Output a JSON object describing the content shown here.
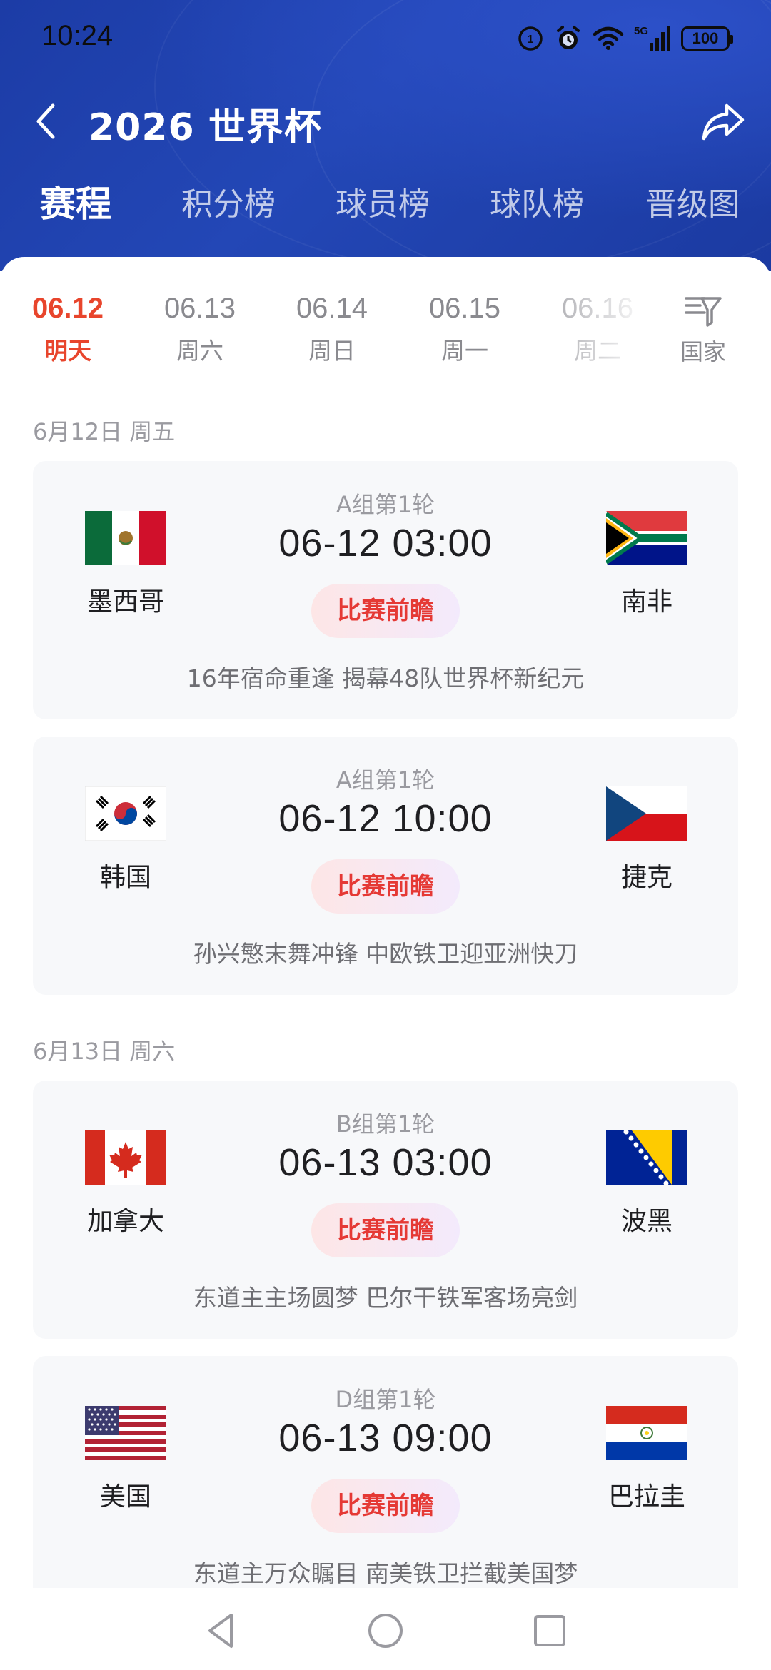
{
  "status_bar": {
    "time": "10:24",
    "battery": "100",
    "network": "5G"
  },
  "header": {
    "title": "2026 世界杯"
  },
  "tabs": [
    {
      "label": "赛程",
      "active": true
    },
    {
      "label": "积分榜"
    },
    {
      "label": "球员榜"
    },
    {
      "label": "球队榜"
    },
    {
      "label": "晋级图"
    }
  ],
  "dates": [
    {
      "date": "06.12",
      "weekday": "明天",
      "active": true
    },
    {
      "date": "06.13",
      "weekday": "周六"
    },
    {
      "date": "06.14",
      "weekday": "周日"
    },
    {
      "date": "06.15",
      "weekday": "周一"
    },
    {
      "date": "06.16",
      "weekday": "周二"
    }
  ],
  "filter": {
    "label": "国家"
  },
  "sections": [
    {
      "label": "6月12日 周五",
      "matches": [
        {
          "round": "A组第1轮",
          "time": "06-12 03:00",
          "home": "墨西哥",
          "away": "南非",
          "preview": "比赛前瞻",
          "desc": "16年宿命重逢 揭幕48队世界杯新纪元"
        },
        {
          "round": "A组第1轮",
          "time": "06-12 10:00",
          "home": "韩国",
          "away": "捷克",
          "preview": "比赛前瞻",
          "desc": "孙兴慜末舞冲锋 中欧铁卫迎亚洲快刀"
        }
      ]
    },
    {
      "label": "6月13日 周六",
      "matches": [
        {
          "round": "B组第1轮",
          "time": "06-13 03:00",
          "home": "加拿大",
          "away": "波黑",
          "preview": "比赛前瞻",
          "desc": "东道主主场圆梦 巴尔干铁军客场亮剑"
        },
        {
          "round": "D组第1轮",
          "time": "06-13 09:00",
          "home": "美国",
          "away": "巴拉圭",
          "preview": "比赛前瞻",
          "desc": "东道主万众瞩目 南美铁卫拦截美国梦"
        }
      ]
    }
  ],
  "colors": {
    "header_bg": "#1f41af",
    "accent": "#e8452c",
    "preview_text": "#e53935"
  }
}
